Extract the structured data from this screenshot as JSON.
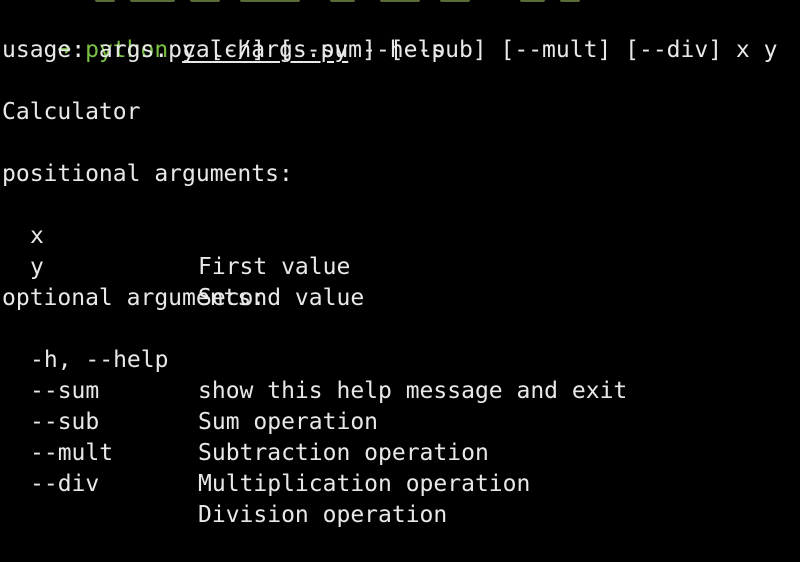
{
  "prompt": {
    "arrow": "➜",
    "command": "python",
    "script": "calc/args.py",
    "flag": "--help"
  },
  "usage": "usage: args.py [-h] [--sum] [--sub] [--mult] [--div] x y",
  "description": "Calculator",
  "positional": {
    "heading": "positional arguments:",
    "args": [
      {
        "name": "x",
        "desc": "First value"
      },
      {
        "name": "y",
        "desc": "Second value"
      }
    ]
  },
  "optional": {
    "heading": "optional arguments:",
    "args": [
      {
        "name": "-h, --help",
        "desc": "show this help message and exit"
      },
      {
        "name": "--sum",
        "desc": "Sum operation"
      },
      {
        "name": "--sub",
        "desc": "Subtraction operation"
      },
      {
        "name": "--mult",
        "desc": "Multiplication operation"
      },
      {
        "name": "--div",
        "desc": "Division operation"
      }
    ]
  },
  "colors": {
    "background": "#000000",
    "text": "#e8e8e8",
    "prompt": "#7bc043"
  }
}
